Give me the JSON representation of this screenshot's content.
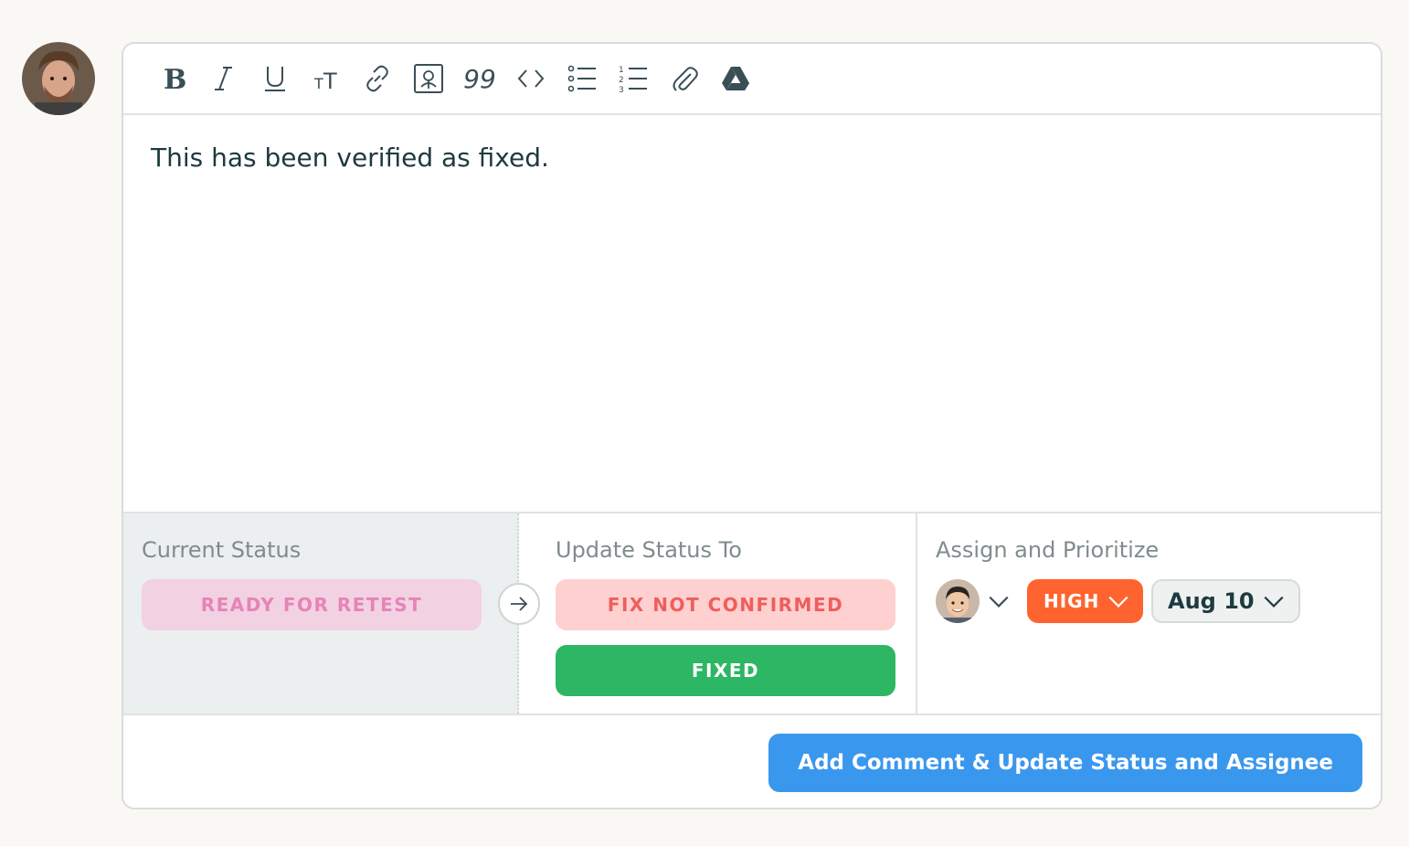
{
  "toolbar": {
    "icons": [
      "bold-icon",
      "italic-icon",
      "underline-icon",
      "text-size-icon",
      "link-icon",
      "image-icon",
      "quote-icon",
      "code-icon",
      "bullet-list-icon",
      "numbered-list-icon",
      "attachment-icon",
      "google-drive-icon"
    ],
    "quote_glyph": "99"
  },
  "editor": {
    "text": "This has been verified as fixed."
  },
  "current_status": {
    "title": "Current Status",
    "value": "READY FOR RETEST"
  },
  "update_status": {
    "title": "Update Status To",
    "options": [
      "FIX NOT CONFIRMED",
      "FIXED"
    ]
  },
  "assign": {
    "title": "Assign and Prioritize",
    "priority": "HIGH",
    "due_date": "Aug 10"
  },
  "footer": {
    "submit_label": "Add Comment & Update Status and Assignee"
  },
  "colors": {
    "accent_blue": "#3a97ee",
    "fixed_green": "#2db663",
    "priority_orange": "#ff6330",
    "current_pink": "#f2d1e3",
    "not_confirmed_red": "#ffd0d0"
  }
}
